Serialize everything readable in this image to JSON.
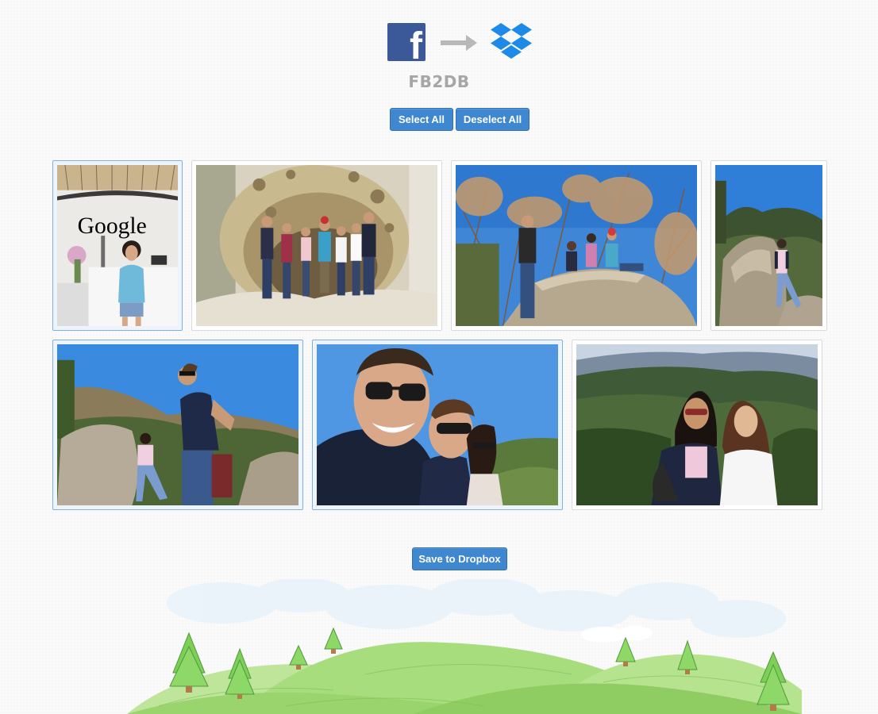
{
  "header": {
    "app_title": "FB2DB",
    "facebook_logo_letter": "f",
    "source_icon": "facebook-icon",
    "arrow_icon": "arrow-right-icon",
    "destination_icon": "dropbox-icon"
  },
  "toolbar": {
    "select_all_label": "Select All",
    "deselect_all_label": "Deselect All"
  },
  "photos": [
    {
      "id": 1,
      "subject": "Person in front of Google logo",
      "sign_text": "Google",
      "selected": true
    },
    {
      "id": 2,
      "subject": "Group photo inside sandstone cave",
      "selected": false
    },
    {
      "id": 3,
      "subject": "Group on rock under blue sky",
      "selected": false
    },
    {
      "id": 4,
      "subject": "Person sitting on boulder",
      "selected": false
    },
    {
      "id": 5,
      "subject": "Two people by boulders",
      "selected": true
    },
    {
      "id": 6,
      "subject": "Selfie with sunglasses",
      "selected": true
    },
    {
      "id": 7,
      "subject": "Two people with forested hills behind",
      "selected": false
    }
  ],
  "footer": {
    "save_label": "Save to Dropbox"
  },
  "colors": {
    "accent": "#3f88d0",
    "facebook": "#3b5998",
    "dropbox": "#1e8ae8",
    "title": "#a6a6a6",
    "selected_border": "#7fb1e2"
  }
}
